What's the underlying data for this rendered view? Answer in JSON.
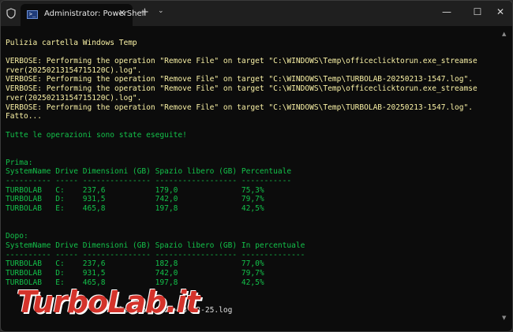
{
  "window": {
    "tab_title": "Administrator: PowerShell",
    "tab_icon_glyph": ">_",
    "tab_close": "✕",
    "new_tab": "+",
    "dropdown": "⌄",
    "minimize": "—",
    "maximize": "☐",
    "close": "✕"
  },
  "terminal": {
    "lines": [
      {
        "text": "",
        "style": "wht"
      },
      {
        "text": "Pulizia cartella Windows Temp",
        "style": "yel"
      },
      {
        "text": "",
        "style": "wht"
      },
      {
        "text": "VERBOSE: Performing the operation \"Remove File\" on target \"C:\\WINDOWS\\Temp\\officeclicktorun.exe_streamse",
        "style": "yel"
      },
      {
        "text": "rver(20250213154715120C).log\".",
        "style": "yel"
      },
      {
        "text": "VERBOSE: Performing the operation \"Remove File\" on target \"C:\\WINDOWS\\Temp\\TURBOLAB-20250213-1547.log\".",
        "style": "yel"
      },
      {
        "text": "VERBOSE: Performing the operation \"Remove File\" on target \"C:\\WINDOWS\\Temp\\officeclicktorun.exe_streamse",
        "style": "yel"
      },
      {
        "text": "rver(20250213154715120C).log\".",
        "style": "yel"
      },
      {
        "text": "VERBOSE: Performing the operation \"Remove File\" on target \"C:\\WINDOWS\\Temp\\TURBOLAB-20250213-1547.log\".",
        "style": "yel"
      },
      {
        "text": "Fatto...",
        "style": "yel"
      },
      {
        "text": "",
        "style": "wht"
      },
      {
        "text": "Tutte le operazioni sono state eseguite!",
        "style": "grn"
      },
      {
        "text": "",
        "style": "wht"
      },
      {
        "text": "",
        "style": "wht"
      },
      {
        "text": "Prima:",
        "style": "grn"
      },
      {
        "text": "SystemName Drive Dimensioni (GB) Spazio libero (GB) Percentuale",
        "style": "grn"
      },
      {
        "text": "---------- ----- --------------- ------------------ -----------",
        "style": "grn"
      },
      {
        "text": "TURBOLAB   C:    237,6           179,0              75,3%",
        "style": "grn"
      },
      {
        "text": "TURBOLAB   D:    931,5           742,0              79,7%",
        "style": "grn"
      },
      {
        "text": "TURBOLAB   E:    465,8           197,8              42,5%",
        "style": "grn"
      },
      {
        "text": "",
        "style": "wht"
      },
      {
        "text": "",
        "style": "wht"
      },
      {
        "text": "Dopo:",
        "style": "grn"
      },
      {
        "text": "SystemName Drive Dimensioni (GB) Spazio libero (GB) In percentuale",
        "style": "grn"
      },
      {
        "text": "---------- ----- --------------- ------------------ --------------",
        "style": "grn"
      },
      {
        "text": "TURBOLAB   C:    237,6           182,8              77,0%",
        "style": "grn"
      },
      {
        "text": "TURBOLAB   D:    931,5           742,0              79,7%",
        "style": "grn"
      },
      {
        "text": "TURBOLAB   E:    465,8           197,8              42,5%",
        "style": "grn"
      },
      {
        "text": "",
        "style": "wht"
      },
      {
        "text": "",
        "style": "wht"
      },
      {
        "text": "                      :\\Cleanup-16.28-13-02-25.log",
        "style": "wht"
      },
      {
        "text": "",
        "style": "wht"
      }
    ]
  },
  "watermark": {
    "text": "TurboLab.it"
  },
  "scrollbar": {
    "up": "▲",
    "down": "▼"
  }
}
